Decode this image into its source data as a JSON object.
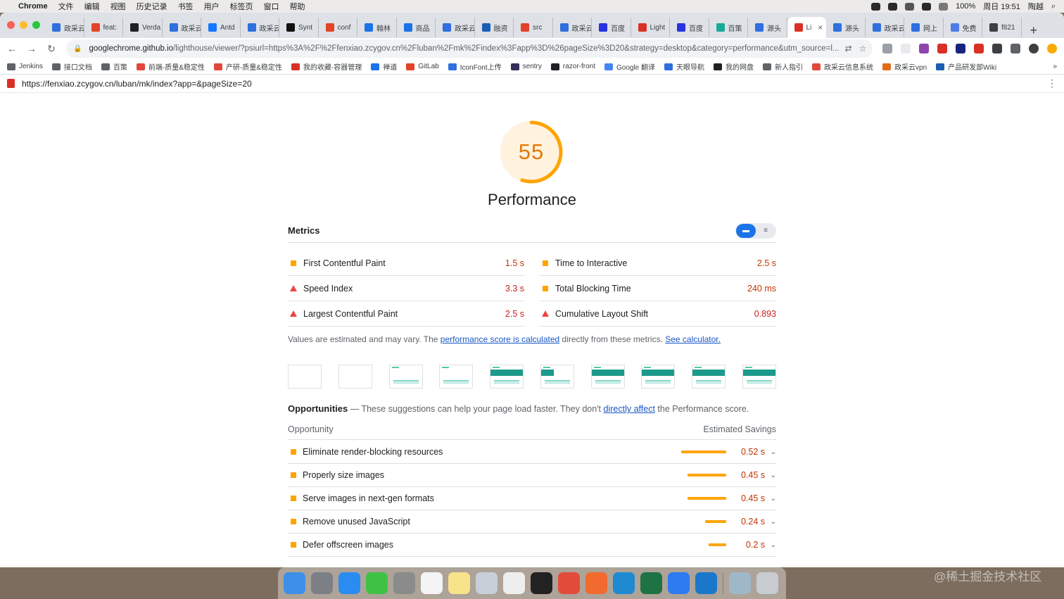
{
  "menubar": {
    "app": "Chrome",
    "menus": [
      "文件",
      "编辑",
      "视图",
      "历史记录",
      "书签",
      "用户",
      "标签页",
      "窗口",
      "帮助"
    ],
    "battery": "100%",
    "clock": "周日 19:51",
    "user": "陶越"
  },
  "tabs": [
    {
      "label": "政采云",
      "color": "#2f6fdf"
    },
    {
      "label": "feat:",
      "color": "#e24329"
    },
    {
      "label": "Verda",
      "color": "#202124"
    },
    {
      "label": "政采云",
      "color": "#2f6fdf"
    },
    {
      "label": "Antd",
      "color": "#1677ff"
    },
    {
      "label": "政采云",
      "color": "#2f6fdf"
    },
    {
      "label": "Synt",
      "color": "#111111"
    },
    {
      "label": "conf",
      "color": "#e24329"
    },
    {
      "label": "翰林",
      "color": "#1a73e8"
    },
    {
      "label": "商品",
      "color": "#1a73e8"
    },
    {
      "label": "政采云",
      "color": "#2f6fdf"
    },
    {
      "label": "融资",
      "color": "#1a5fb4"
    },
    {
      "label": "src",
      "color": "#e24329"
    },
    {
      "label": "政采云",
      "color": "#2f6fdf"
    },
    {
      "label": "百度",
      "color": "#2932e1"
    },
    {
      "label": "Light",
      "color": "#d93025"
    },
    {
      "label": "百度",
      "color": "#2932e1"
    },
    {
      "label": "百策",
      "color": "#18a999"
    },
    {
      "label": "源头",
      "color": "#2f6fdf"
    },
    {
      "label": "Li",
      "color": "#d93025",
      "active": true
    },
    {
      "label": "源头",
      "color": "#2f6fdf"
    },
    {
      "label": "政采云",
      "color": "#2f6fdf"
    },
    {
      "label": "网上",
      "color": "#2f6fdf"
    },
    {
      "label": "免费",
      "color": "#4f7ce6"
    },
    {
      "label": "f821",
      "color": "#3c4043"
    }
  ],
  "address": {
    "host": "googlechrome.github.io",
    "path": "/lighthouse/viewer/?psiurl=https%3A%2F%2Ffenxiao.zcygov.cn%2Fluban%2Fmk%2Findex%3Fapp%3D%26pageSize%3D20&strategy=desktop&category=performance&utm_source=l..."
  },
  "bookmarks": [
    {
      "label": "Jenkins",
      "color": "#5f6368"
    },
    {
      "label": "接口文档",
      "color": "#5f6368"
    },
    {
      "label": "百策",
      "color": "#5f6368"
    },
    {
      "label": "前端-质量&稳定性",
      "color": "#e0483e"
    },
    {
      "label": "产研-质量&稳定性",
      "color": "#e0483e"
    },
    {
      "label": "我的收藏-容器管理",
      "color": "#d93025"
    },
    {
      "label": "禅道",
      "color": "#1a73e8"
    },
    {
      "label": "GitLab",
      "color": "#e24329"
    },
    {
      "label": "IconFont上传",
      "color": "#2f6fdf"
    },
    {
      "label": "sentry",
      "color": "#362d59"
    },
    {
      "label": "razor-front",
      "color": "#202124"
    },
    {
      "label": "Google 翻译",
      "color": "#4285f4"
    },
    {
      "label": "天眼导航",
      "color": "#2f6fdf"
    },
    {
      "label": "我的网盘",
      "color": "#202124"
    },
    {
      "label": "新人指引",
      "color": "#5f6368"
    },
    {
      "label": "政采云信息系统",
      "color": "#e0483e"
    },
    {
      "label": "政采云vpn",
      "color": "#e36c1b"
    },
    {
      "label": "产品研发部Wiki",
      "color": "#1a5fb4"
    }
  ],
  "page_url": "https://fenxiao.zcygov.cn/luban/mk/index?app=&pageSize=20",
  "report": {
    "score": "55",
    "score_value": 55,
    "title": "Performance",
    "metrics_title": "Metrics",
    "metrics": [
      {
        "name": "First Contentful Paint",
        "value": "1.5 s",
        "status": "average"
      },
      {
        "name": "Time to Interactive",
        "value": "2.5 s",
        "status": "average"
      },
      {
        "name": "Speed Index",
        "value": "3.3 s",
        "status": "fail"
      },
      {
        "name": "Total Blocking Time",
        "value": "240 ms",
        "status": "average"
      },
      {
        "name": "Largest Contentful Paint",
        "value": "2.5 s",
        "status": "fail"
      },
      {
        "name": "Cumulative Layout Shift",
        "value": "0.893",
        "status": "fail"
      }
    ],
    "note_prefix": "Values are estimated and may vary. The ",
    "note_link1": "performance score is calculated",
    "note_middle": " directly from these metrics. ",
    "note_link2": "See calculator.",
    "filmstrip_frames": [
      {
        "state": "blank"
      },
      {
        "state": "blank"
      },
      {
        "state": "light"
      },
      {
        "state": "light"
      },
      {
        "state": "full"
      },
      {
        "state": "partial"
      },
      {
        "state": "full"
      },
      {
        "state": "full"
      },
      {
        "state": "full"
      },
      {
        "state": "full"
      }
    ],
    "opportunities_title": "Opportunities",
    "opportunities_sep": " — ",
    "opportunities_desc1": "These suggestions can help your page load faster. They don't ",
    "opportunities_link": "directly affect",
    "opportunities_desc2": " the Performance score.",
    "col_opportunity": "Opportunity",
    "col_savings": "Estimated Savings",
    "opportunities": [
      {
        "name": "Eliminate render-blocking resources",
        "saving": "0.52 s",
        "seconds": 0.52
      },
      {
        "name": "Properly size images",
        "saving": "0.45 s",
        "seconds": 0.45
      },
      {
        "name": "Serve images in next-gen formats",
        "saving": "0.45 s",
        "seconds": 0.45
      },
      {
        "name": "Remove unused JavaScript",
        "saving": "0.24 s",
        "seconds": 0.24
      },
      {
        "name": "Defer offscreen images",
        "saving": "0.2 s",
        "seconds": 0.2
      }
    ]
  },
  "dock": [
    {
      "name": "finder",
      "color": "#3d8fe8"
    },
    {
      "name": "launchpad",
      "color": "#7d7f86"
    },
    {
      "name": "safari",
      "color": "#2a8cf0"
    },
    {
      "name": "wechat",
      "color": "#3fc244"
    },
    {
      "name": "system-preferences",
      "color": "#8b8b8b"
    },
    {
      "name": "calendar",
      "color": "#f4f4f4"
    },
    {
      "name": "notes",
      "color": "#f6e38a"
    },
    {
      "name": "preview",
      "color": "#c7cfd8"
    },
    {
      "name": "typora",
      "color": "#eeeeee"
    },
    {
      "name": "terminal",
      "color": "#222222"
    },
    {
      "name": "chrome",
      "color": "#e34c3a"
    },
    {
      "name": "brave",
      "color": "#f26a2e"
    },
    {
      "name": "vscode",
      "color": "#1f8ad2"
    },
    {
      "name": "excel",
      "color": "#1f7244"
    },
    {
      "name": "feishu",
      "color": "#2e7af0"
    },
    {
      "name": "edge",
      "color": "#1a77c9"
    },
    {
      "name": "downloads",
      "color": "#9fb8c8"
    },
    {
      "name": "trash",
      "color": "#c8ccd0"
    }
  ],
  "watermark": "@稀土掘金技术社区"
}
